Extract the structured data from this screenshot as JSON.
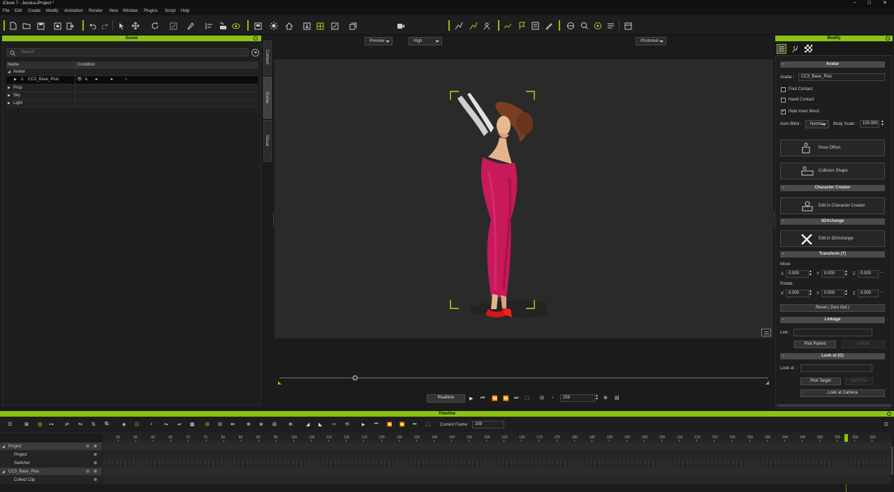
{
  "window": {
    "title": "iClone 7 - Jessica.iProject *"
  },
  "menu": [
    "File",
    "Edit",
    "Create",
    "Modify",
    "Animation",
    "Render",
    "View",
    "Window",
    "Plugins",
    "Script",
    "Help"
  ],
  "toolbar": {
    "preview_mode": "Preview",
    "quality": "High",
    "render_style": "Photoreal"
  },
  "scene": {
    "title": "Scene",
    "search_placeholder": "Search",
    "col_name": "Name",
    "col_condition": "Condition",
    "rows": [
      "Avatar",
      "CC3_Base_Plus",
      "Prop",
      "Sky",
      "Light"
    ],
    "side_tabs": [
      "Content",
      "Scene",
      "Visual"
    ]
  },
  "viewport": {
    "realtime_label": "Realtime",
    "frame_value": "259"
  },
  "modify": {
    "title": "Modify",
    "avatar_section": "Avatar",
    "avatar_label": "Avatar :",
    "avatar_value": "CC3_Base_Plus",
    "foot_contact": "Foot Contact",
    "hand_contact": "Hand Contact",
    "hide_inner_mesh": "Hide Inner Mesh",
    "auto_blink_label": "Auto-Blink :",
    "auto_blink_value": "Norma",
    "body_scale_label": "Body Scale :",
    "body_scale_value": "100.000",
    "pose_offset": "Pose Offset",
    "collision_shape": "Collision Shape",
    "character_creator_section": "Character Creator",
    "edit_cc": "Edit in Character Creator",
    "xchange_section": "3DXchange",
    "edit_3dx": "Edit in 3DXchange",
    "transform_section": "Transform  (T)",
    "move_label": "Move",
    "rotate_label": "Rotate",
    "axis_x": "X",
    "axis_y": "Y",
    "axis_z": "Z",
    "move": {
      "x": "0.000",
      "y": "0.000",
      "z": "0.000"
    },
    "rotate": {
      "x": "0.000",
      "y": "0.000",
      "z": "0.000"
    },
    "reset_btn": "Reset ( Zero Out )",
    "linkage_section": "Linkage",
    "link_label": "Link :",
    "pick_parent": "Pick Parent",
    "update": "Update",
    "lookat_section": "Look at  (O)",
    "lookat_label": "Look at :",
    "pick_target": "Pick Target",
    "set_free": "Set Free",
    "look_at_camera": "Look at Camera"
  },
  "timeline": {
    "title": "Timeline",
    "current_frame_label": "Current Frame :",
    "current_frame": "259",
    "ticks": [
      "50",
      "55",
      "60",
      "65",
      "70",
      "75",
      "80",
      "85",
      "90",
      "95",
      "100",
      "105",
      "110",
      "115",
      "120",
      "125",
      "130",
      "135",
      "140",
      "145",
      "150",
      "155",
      "160",
      "165",
      "170",
      "175",
      "180",
      "185",
      "190",
      "195",
      "200",
      "205",
      "210",
      "215",
      "220",
      "225",
      "230",
      "235",
      "240",
      "245",
      "250",
      "255",
      "260",
      "265"
    ],
    "tracks": [
      "Project",
      "Project",
      "Switcher",
      "CC3_Base_Plus",
      "Collect Clip"
    ]
  },
  "colors": {
    "accent": "#8bc313",
    "bg": "#1b1b1b",
    "viewport": "#2a2a2a",
    "dress": "#c8195a"
  }
}
